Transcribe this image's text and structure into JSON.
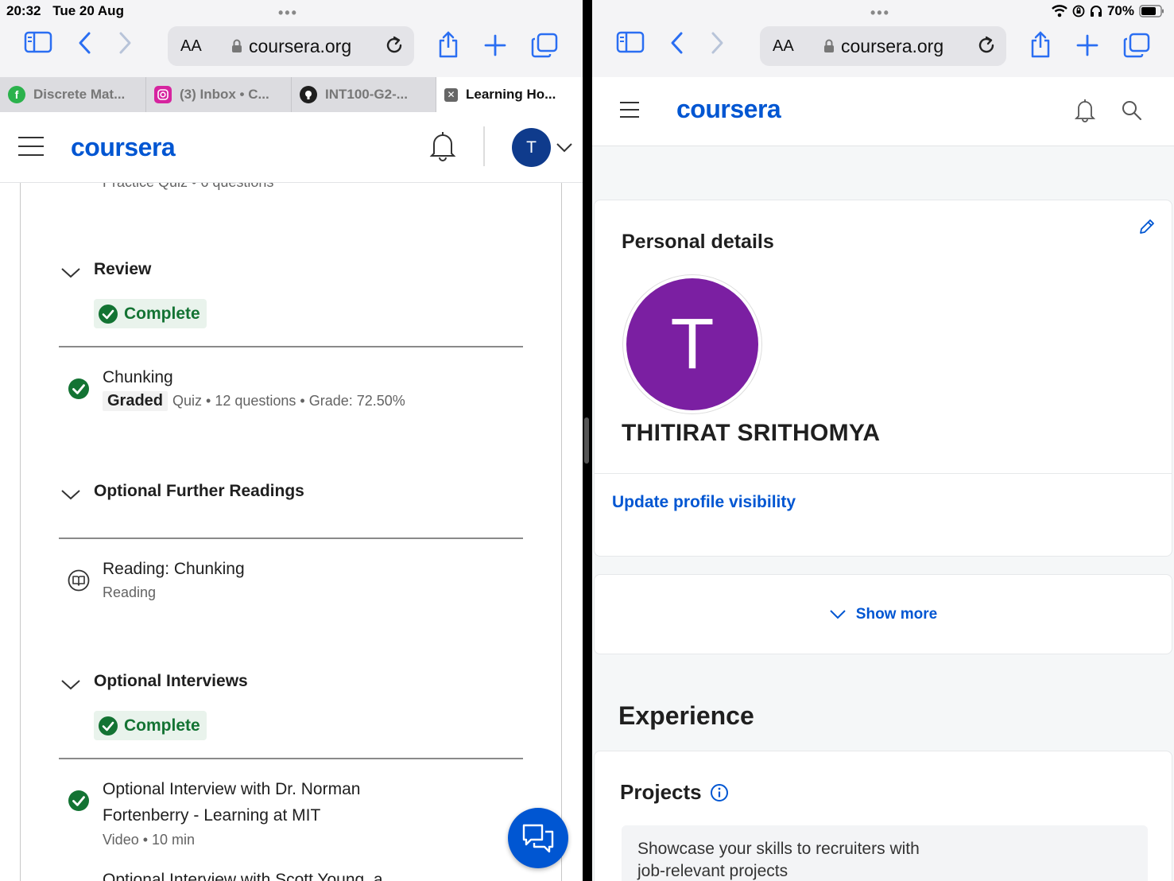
{
  "status_bar": {
    "time": "20:32",
    "date": "Tue 20 Aug",
    "battery": "70%"
  },
  "left": {
    "browser": {
      "text_size": "AA",
      "url": "coursera.org",
      "tabs": [
        {
          "label": "Discrete Mat...",
          "icon": "feedly-icon",
          "color": "#2bb24c"
        },
        {
          "label": "(3) Inbox • C...",
          "icon": "instagram-icon",
          "color": "#d6249f"
        },
        {
          "label": "INT100-G2-...",
          "icon": "github-icon",
          "color": "#1f1f1f"
        },
        {
          "label": "Learning Ho...",
          "icon": "close-tab-icon",
          "color": "#666666"
        }
      ]
    },
    "header": {
      "logo": "coursera",
      "avatar_initial": "T"
    },
    "clipped_text": "Practice Quiz • 6 questions",
    "sections": [
      {
        "title": "Review",
        "badge": "Complete"
      },
      {
        "title": "Optional Further Readings"
      },
      {
        "title": "Optional Interviews",
        "badge": "Complete"
      }
    ],
    "items": {
      "chunking": {
        "title": "Chunking",
        "tag": "Graded",
        "meta": "Quiz • 12 questions • Grade: 72.50%"
      },
      "reading": {
        "title": "Reading: Chunking",
        "meta": "Reading"
      },
      "interview1": {
        "title_line1": "Optional Interview with Dr. Norman",
        "title_line2": "Fortenberry - Learning at MIT",
        "meta": "Video • 10 min"
      },
      "interview2_clipped": "Optional Interview with Scott Young, a"
    }
  },
  "right": {
    "browser": {
      "text_size": "AA",
      "url": "coursera.org"
    },
    "header": {
      "logo": "coursera"
    },
    "personal": {
      "title": "Personal details",
      "avatar_initial": "T",
      "name": "THITIRAT SRITHOMYA",
      "visibility_link": "Update profile visibility"
    },
    "show_more": "Show more",
    "experience": {
      "title": "Experience",
      "projects_title": "Projects",
      "showcase_line1": "Showcase your skills to recruiters with",
      "showcase_line2": "job-relevant projects"
    }
  },
  "colors": {
    "brand": "#0056d2",
    "complete": "#137333",
    "avatar_purple": "#7b1fa2",
    "avatar_navy": "#0f3b8c"
  }
}
